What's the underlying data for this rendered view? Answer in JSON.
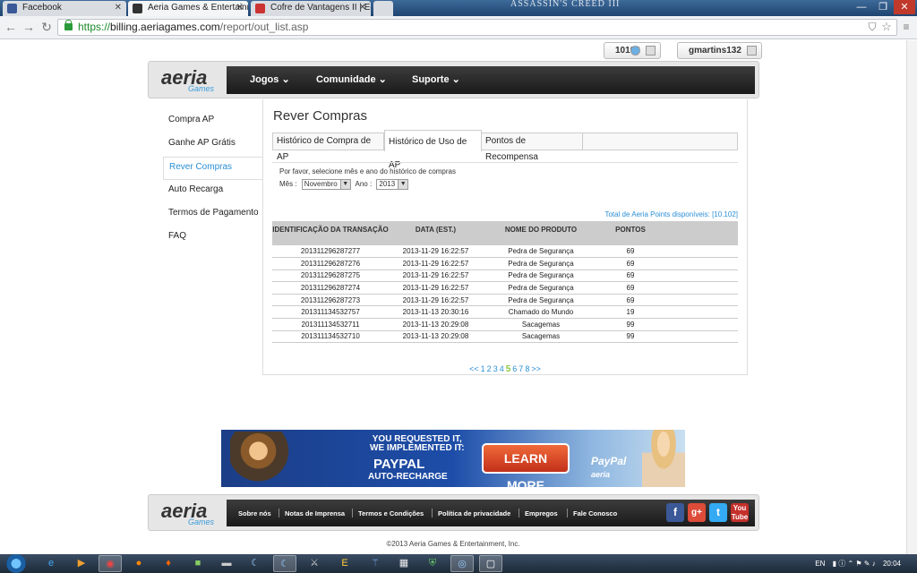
{
  "browser": {
    "tabs": [
      {
        "label": "Facebook",
        "active": false
      },
      {
        "label": "Aeria Games & Entertainm",
        "active": true
      },
      {
        "label": "Cofre de Vantagens II | Edi",
        "active": false
      }
    ],
    "url_secure": "https://",
    "url_host": "billing.aeriagames.com",
    "url_path": "/report/out_list.asp",
    "window_logo": "ASSASSIN'S CREED III"
  },
  "user": {
    "points": "10102",
    "username": "gmartins132"
  },
  "header": {
    "logo": "aeria",
    "logo_sub": "Games",
    "nav": [
      "Jogos",
      "Comunidade",
      "Suporte"
    ]
  },
  "sidebar": {
    "items": [
      {
        "label": "Compra AP",
        "active": false
      },
      {
        "label": "Ganhe AP Grátis",
        "active": false
      },
      {
        "label": "Rever Compras",
        "active": true
      },
      {
        "label": "Auto Recarga",
        "active": false
      },
      {
        "label": "Termos de Pagamento",
        "active": false
      },
      {
        "label": "FAQ",
        "active": false
      }
    ]
  },
  "main": {
    "title": "Rever Compras",
    "tabs": [
      {
        "label": "Histórico de Compra de AP",
        "active": false
      },
      {
        "label": "Histórico de Uso de AP",
        "active": true
      },
      {
        "label": "Pontos de Recompensa",
        "active": false
      }
    ],
    "instruction": "Por favor, selecione mês e ano do histórico de compras",
    "month_label": "Mês :",
    "month_value": "Novembro",
    "year_label": "Ano :",
    "year_value": "2013",
    "total_label": "Total de Aeria Points disponíveis:",
    "total_value": "[10.102]",
    "table": {
      "headers": [
        "IDENTIFICAÇÃO DA TRANSAÇÃO",
        "DATA (EST.)",
        "NOME DO PRODUTO",
        "PONTOS"
      ],
      "rows": [
        [
          "201311296287277",
          "2013-11-29 16:22:57",
          "Pedra de Segurança",
          "69"
        ],
        [
          "201311296287276",
          "2013-11-29 16:22:57",
          "Pedra de Segurança",
          "69"
        ],
        [
          "201311296287275",
          "2013-11-29 16:22:57",
          "Pedra de Segurança",
          "69"
        ],
        [
          "201311296287274",
          "2013-11-29 16:22:57",
          "Pedra de Segurança",
          "69"
        ],
        [
          "201311296287273",
          "2013-11-29 16:22:57",
          "Pedra de Segurança",
          "69"
        ],
        [
          "201311134532757",
          "2013-11-13 20:30:16",
          "Chamado do Mundo",
          "19"
        ],
        [
          "201311134532711",
          "2013-11-13 20:29:08",
          "Sacagemas",
          "99"
        ],
        [
          "201311134532710",
          "2013-11-13 20:29:08",
          "Sacagemas",
          "99"
        ]
      ]
    },
    "pager": {
      "prev": "<<",
      "pages": [
        "1",
        "2",
        "3",
        "4",
        "5",
        "6",
        "7",
        "8"
      ],
      "current": "5",
      "next": ">>"
    }
  },
  "banner": {
    "line1": "YOU REQUESTED IT,",
    "line2": "WE IMPLEMENTED IT:",
    "line3": "PAYPAL",
    "line4": "AUTO-RECHARGE",
    "button": "LEARN MORE",
    "paypal": "PayPal",
    "brand": "aeria"
  },
  "footer": {
    "logo": "aeria",
    "logo_sub": "Games",
    "links": [
      "Sobre nós",
      "Notas de Imprensa",
      "Termos e Condições",
      "Política de privacidade",
      "Empregos",
      "Fale Conosco"
    ],
    "copyright": "©2013 Aeria Games & Entertainment, Inc."
  },
  "taskbar": {
    "lang": "EN",
    "time": "20:04"
  },
  "colors": {
    "accent": "#2a8fd6",
    "pager_current": "#8cc63f",
    "nav_bg": "#1a1a1a"
  }
}
